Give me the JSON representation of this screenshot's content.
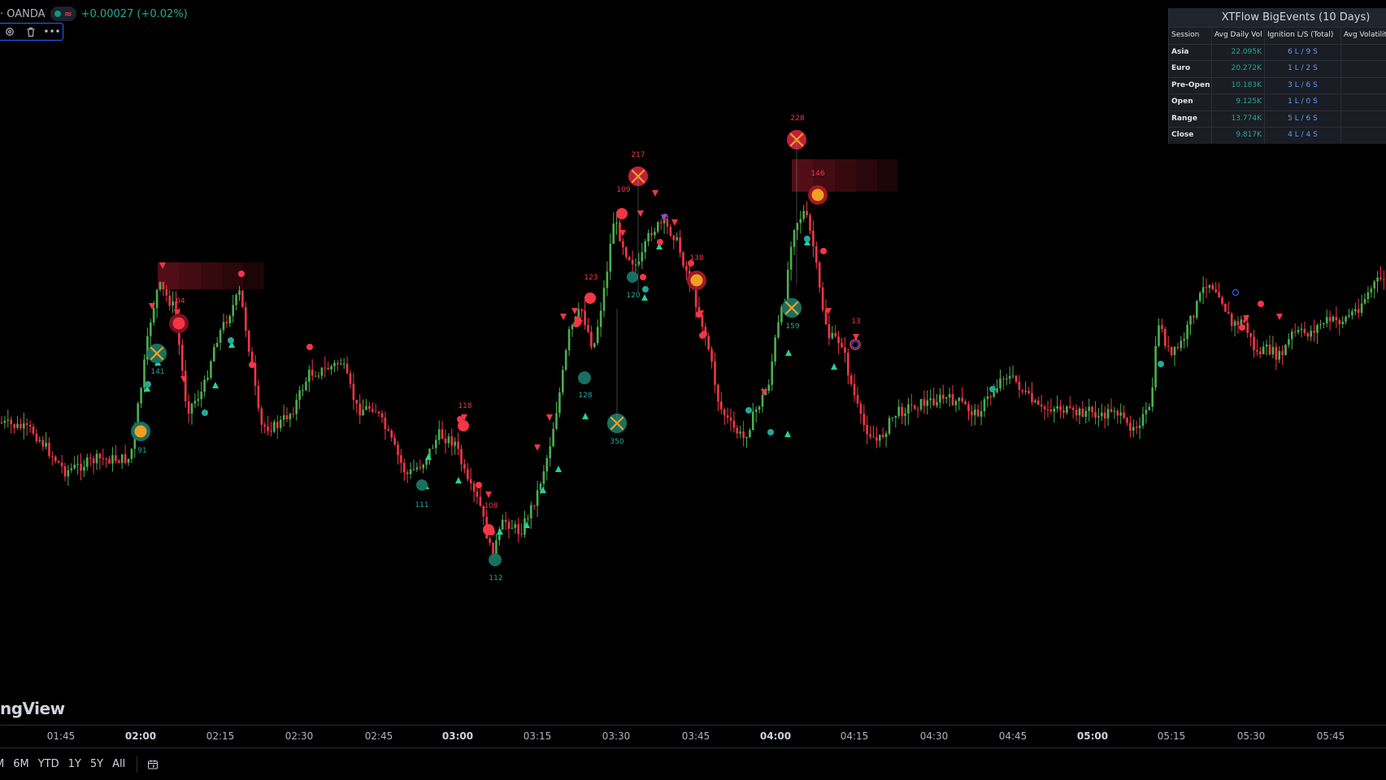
{
  "legend": {
    "broker": "· OANDA",
    "change": "+0.00027 (+0.02%)",
    "live_indicator_color": "#089981",
    "wave_symbol": "≈",
    "icons": [
      "settings-icon",
      "trash-icon",
      "more-icon"
    ],
    "more_label": "•••"
  },
  "table": {
    "title": "XTFlow BigEvents (10 Days)",
    "headers": [
      "Session",
      "Avg Daily Vol",
      "Ignition L/S (Total)",
      "Avg Volatilit"
    ],
    "rows": [
      {
        "session": "Asia",
        "vol": "22.095K",
        "ignition": "6 L / 9 S"
      },
      {
        "session": "Euro",
        "vol": "20.272K",
        "ignition": "1 L / 2 S"
      },
      {
        "session": "Pre-Open",
        "vol": "10.183K",
        "ignition": "3 L / 6 S"
      },
      {
        "session": "Open",
        "vol": "9.125K",
        "ignition": "1 L / 0 S"
      },
      {
        "session": "Range",
        "vol": "13.774K",
        "ignition": "5 L / 6 S"
      },
      {
        "session": "Close",
        "vol": "9.817K",
        "ignition": "4 L / 4 S"
      }
    ]
  },
  "watermark": "ngView",
  "time_axis": [
    {
      "label": "01:45",
      "bold": false
    },
    {
      "label": "02:00",
      "bold": true
    },
    {
      "label": "02:15",
      "bold": false
    },
    {
      "label": "02:30",
      "bold": false
    },
    {
      "label": "02:45",
      "bold": false
    },
    {
      "label": "03:00",
      "bold": true
    },
    {
      "label": "03:15",
      "bold": false
    },
    {
      "label": "03:30",
      "bold": false
    },
    {
      "label": "03:45",
      "bold": false
    },
    {
      "label": "04:00",
      "bold": true
    },
    {
      "label": "04:15",
      "bold": false
    },
    {
      "label": "04:30",
      "bold": false
    },
    {
      "label": "04:45",
      "bold": false
    },
    {
      "label": "05:00",
      "bold": true
    },
    {
      "label": "05:15",
      "bold": false
    },
    {
      "label": "05:30",
      "bold": false
    },
    {
      "label": "05:45",
      "bold": false
    }
  ],
  "range_buttons": [
    "M",
    "6M",
    "YTD",
    "1Y",
    "5Y",
    "All"
  ],
  "calendar_icon": "calendar-icon",
  "colors": {
    "up": "#26a69a",
    "up_bright": "#22d39a",
    "green_candle": "#4caf50",
    "down": "#f23645",
    "event_orange": "#f0a020",
    "zone": "#5a0f18"
  },
  "event_labels": [
    "91",
    "141",
    "04",
    "118",
    "111",
    "108",
    "112",
    "123",
    "128",
    "350",
    "217",
    "109",
    "120",
    "138",
    "228",
    "146",
    "159",
    "13"
  ]
}
